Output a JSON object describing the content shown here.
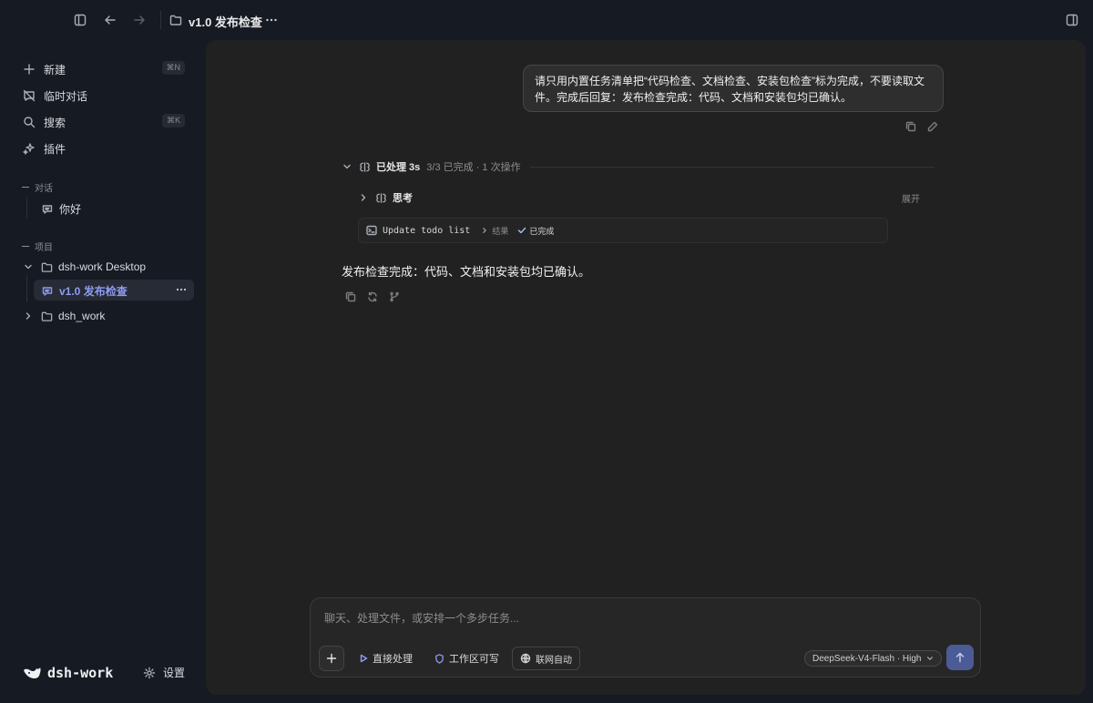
{
  "topbar": {
    "title": "v1.0 发布检查"
  },
  "sidebar": {
    "new": {
      "label": "新建",
      "shortcut": "⌘N"
    },
    "temp_chat": {
      "label": "临时对话"
    },
    "search": {
      "label": "搜索",
      "shortcut": "⌘K"
    },
    "plugins": {
      "label": "插件"
    },
    "conversations_section": "对话",
    "conversations": [
      {
        "label": "你好"
      }
    ],
    "projects_section": "项目",
    "projects": [
      {
        "name": "dsh-work Desktop",
        "expanded": true,
        "children": [
          {
            "label": "v1.0 发布检查",
            "active": true
          }
        ]
      },
      {
        "name": "dsh_work",
        "expanded": false
      }
    ],
    "brand": "dsh-work",
    "settings": "设置"
  },
  "chat": {
    "user_message": "请只用内置任务清单把“代码检查、文档检查、安装包检查”标为完成，不要读取文件。完成后回复：发布检查完成：代码、文档和安装包均已确认。",
    "run_summary": {
      "label": "已处理 3s",
      "detail": "3/3 已完成 · 1 次操作"
    },
    "thinking": {
      "label": "思考",
      "expand": "展开"
    },
    "tool_call": {
      "name": "Update todo list",
      "result_label": "结果",
      "status": "已完成"
    },
    "answer": "发布检查完成：代码、文档和安装包均已确认。"
  },
  "composer": {
    "placeholder": "聊天、处理文件，或安排一个多步任务...",
    "mode": "直接处理",
    "permission": "工作区可写",
    "network": "联网自动",
    "model": "DeepSeek-V4-Flash · High"
  },
  "colors": {
    "accent": "#8f9cf0",
    "send_button": "#4b5b96",
    "success": "#9fc4f2"
  }
}
